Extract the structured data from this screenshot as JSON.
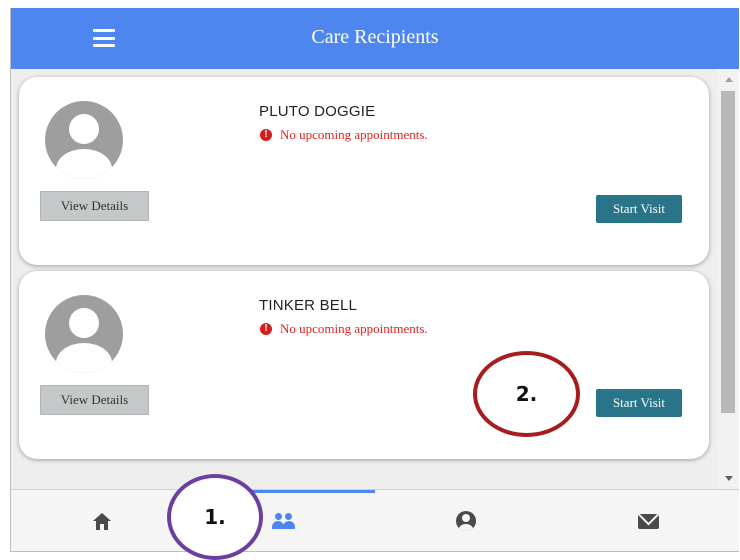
{
  "appbar": {
    "title": "Care Recipients",
    "menu_icon": "hamburger-menu-icon",
    "color": "#4e86f0"
  },
  "recipients": [
    {
      "name": "PLUTO DOGGIE",
      "appointment_status": "No upcoming appointments.",
      "status_icon": "exclamation-circle-icon",
      "view_details_label": "View Details",
      "start_visit_label": "Start Visit"
    },
    {
      "name": "TINKER BELL",
      "appointment_status": "No upcoming appointments.",
      "status_icon": "exclamation-circle-icon",
      "view_details_label": "View Details",
      "start_visit_label": "Start Visit"
    }
  ],
  "bottom_nav": {
    "active_tab": "care-recipients",
    "tabs": [
      {
        "id": "home",
        "icon": "home-icon"
      },
      {
        "id": "care-recipients",
        "icon": "people-icon"
      },
      {
        "id": "account",
        "icon": "account-circle-icon"
      },
      {
        "id": "messages",
        "icon": "mail-icon"
      }
    ]
  },
  "annotations": {
    "callout_1": "1.",
    "callout_2": "2.",
    "callout_1_color": "#6b3fa0",
    "callout_2_color": "#a51d1d"
  },
  "colors": {
    "start_visit": "#2a7489",
    "warning": "#e32222",
    "view_details": "#c5c8c8"
  }
}
